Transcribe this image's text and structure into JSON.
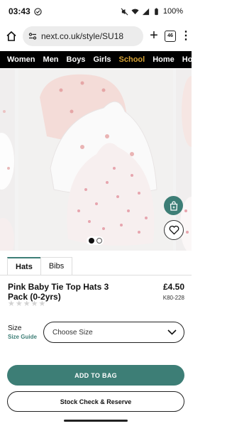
{
  "status_bar": {
    "time": "03:43",
    "battery": "100%"
  },
  "browser": {
    "url": "next.co.uk/style/SU18",
    "tab_count": "46"
  },
  "site_nav": {
    "items": [
      "Women",
      "Men",
      "Boys",
      "Girls",
      "School",
      "Home",
      "Holid"
    ],
    "highlight_color": "#d6a335"
  },
  "gallery": {
    "current_index": 1,
    "total": 2
  },
  "tabs": [
    "Hats",
    "Bibs"
  ],
  "product": {
    "title": "Pink Baby Tie Top Hats 3 Pack (0-2yrs)",
    "price": "£4.50",
    "code": "K80-228",
    "rating_stars": 0,
    "max_stars": 5
  },
  "size": {
    "label": "Size",
    "guide_label": "Size Guide",
    "placeholder": "Choose Size"
  },
  "actions": {
    "add_to_bag": "ADD TO BAG",
    "stock_check": "Stock Check & Reserve"
  },
  "colors": {
    "brand_teal": "#3d7e76",
    "nav_bg": "#000000"
  }
}
